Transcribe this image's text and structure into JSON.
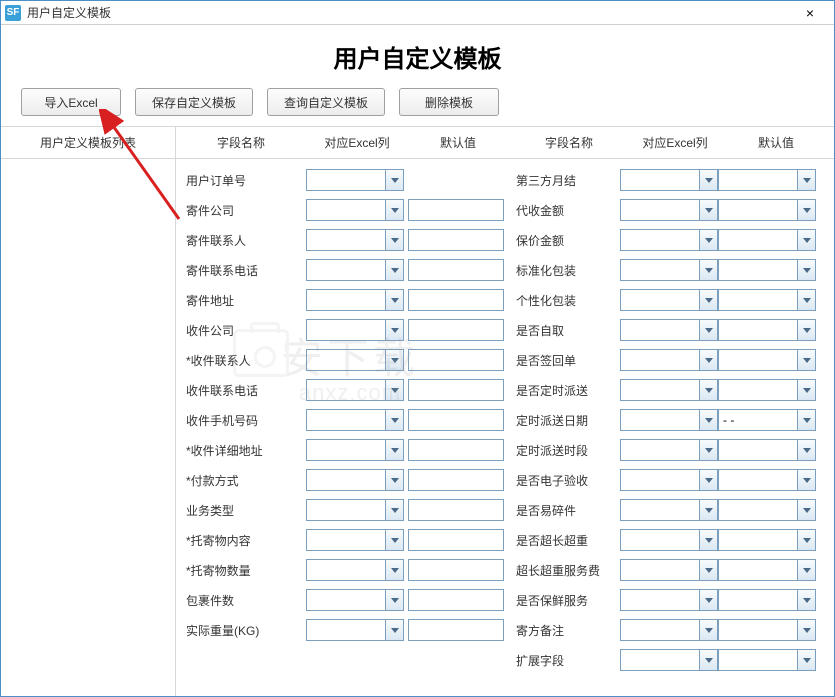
{
  "window": {
    "title": "用户自定义模板",
    "close_icon": "×"
  },
  "page_title": "用户自定义模板",
  "toolbar": {
    "import_excel": "导入Excel",
    "save_template": "保存自定义模板",
    "query_template": "查询自定义模板",
    "delete_template": "删除模板"
  },
  "sidebar": {
    "header": "用户定义模板列表"
  },
  "columns": {
    "left": {
      "field_name": "字段名称",
      "excel_col": "对应Excel列",
      "default_val": "默认值"
    },
    "right": {
      "field_name": "字段名称",
      "excel_col": "对应Excel列",
      "default_val": "默认值"
    }
  },
  "left_fields": [
    {
      "label": "用户订单号",
      "excel": "",
      "def": null
    },
    {
      "label": "寄件公司",
      "excel": "",
      "def": ""
    },
    {
      "label": "寄件联系人",
      "excel": "",
      "def": ""
    },
    {
      "label": "寄件联系电话",
      "excel": "",
      "def": ""
    },
    {
      "label": "寄件地址",
      "excel": "",
      "def": ""
    },
    {
      "label": "收件公司",
      "excel": "",
      "def": ""
    },
    {
      "label": "*收件联系人",
      "excel": "",
      "def": ""
    },
    {
      "label": "收件联系电话",
      "excel": "",
      "def": ""
    },
    {
      "label": "收件手机号码",
      "excel": "",
      "def": ""
    },
    {
      "label": "*收件详细地址",
      "excel": "",
      "def": ""
    },
    {
      "label": "*付款方式",
      "excel": "",
      "def": ""
    },
    {
      "label": "业务类型",
      "excel": "",
      "def": ""
    },
    {
      "label": "*托寄物内容",
      "excel": "",
      "def": ""
    },
    {
      "label": "*托寄物数量",
      "excel": "",
      "def": ""
    },
    {
      "label": "包裹件数",
      "excel": "",
      "def": ""
    },
    {
      "label": "实际重量(KG)",
      "excel": "",
      "def": ""
    }
  ],
  "right_fields": [
    {
      "label": "第三方月结",
      "excel": "",
      "def": ""
    },
    {
      "label": "代收金额",
      "excel": "",
      "def": ""
    },
    {
      "label": "保价金额",
      "excel": "",
      "def": ""
    },
    {
      "label": "标准化包装",
      "excel": "",
      "def": ""
    },
    {
      "label": "个性化包装",
      "excel": "",
      "def": ""
    },
    {
      "label": "是否自取",
      "excel": "",
      "def": ""
    },
    {
      "label": "是否签回单",
      "excel": "",
      "def": ""
    },
    {
      "label": "是否定时派送",
      "excel": "",
      "def": ""
    },
    {
      "label": "定时派送日期",
      "excel": "",
      "def": "- -"
    },
    {
      "label": "定时派送时段",
      "excel": "",
      "def": ""
    },
    {
      "label": "是否电子验收",
      "excel": "",
      "def": ""
    },
    {
      "label": "是否易碎件",
      "excel": "",
      "def": ""
    },
    {
      "label": "是否超长超重",
      "excel": "",
      "def": ""
    },
    {
      "label": "超长超重服务费",
      "excel": "",
      "def": ""
    },
    {
      "label": "是否保鲜服务",
      "excel": "",
      "def": ""
    },
    {
      "label": "寄方备注",
      "excel": "",
      "def": ""
    },
    {
      "label": "扩展字段",
      "excel": "",
      "def": ""
    }
  ],
  "watermark": {
    "line1": "安下载",
    "line2": "anxz.com"
  }
}
